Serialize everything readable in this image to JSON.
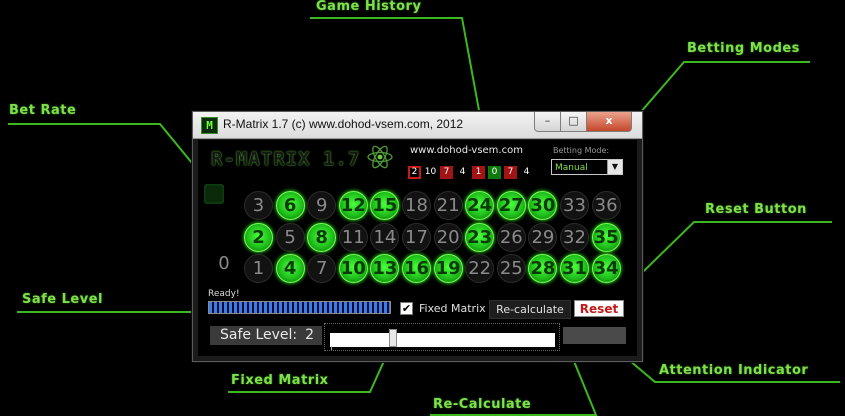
{
  "callouts": {
    "game_history": "Game History",
    "betting_modes": "Betting Modes",
    "bet_rate": "Bet Rate",
    "reset_button": "Reset Button",
    "safe_level": "Safe Level",
    "fixed_matrix": "Fixed Matrix",
    "recalculate": "Re-Calculate",
    "attention_indicator": "Attention Indicator"
  },
  "window": {
    "title": "R-Matrix 1.7 (c) www.dohod-vsem.com, 2012",
    "icon_letter": "M",
    "controls": {
      "minimize": "–",
      "maximize": "□",
      "close": "x"
    }
  },
  "header": {
    "logo": "R-MATRIX 1.7",
    "website": "www.dohod-vsem.com",
    "betting_mode_label": "Betting Mode:",
    "betting_mode_value": "Manual"
  },
  "history": [
    {
      "n": "2",
      "c": "first"
    },
    {
      "n": "10",
      "c": "black"
    },
    {
      "n": "7",
      "c": "red"
    },
    {
      "n": "4",
      "c": "black"
    },
    {
      "n": "1",
      "c": "red"
    },
    {
      "n": "0",
      "c": "green"
    },
    {
      "n": "7",
      "c": "red"
    },
    {
      "n": "4",
      "c": "black"
    }
  ],
  "table": {
    "zero": "0",
    "rows": [
      [
        {
          "n": "3",
          "on": false
        },
        {
          "n": "6",
          "on": true
        },
        {
          "n": "9",
          "on": false
        },
        {
          "n": "12",
          "on": true
        },
        {
          "n": "15",
          "on": true
        },
        {
          "n": "18",
          "on": false
        },
        {
          "n": "21",
          "on": false
        },
        {
          "n": "24",
          "on": true
        },
        {
          "n": "27",
          "on": true
        },
        {
          "n": "30",
          "on": true
        },
        {
          "n": "33",
          "on": false
        },
        {
          "n": "36",
          "on": false
        }
      ],
      [
        {
          "n": "2",
          "on": true
        },
        {
          "n": "5",
          "on": false
        },
        {
          "n": "8",
          "on": true
        },
        {
          "n": "11",
          "on": false
        },
        {
          "n": "14",
          "on": false
        },
        {
          "n": "17",
          "on": false
        },
        {
          "n": "20",
          "on": false
        },
        {
          "n": "23",
          "on": true
        },
        {
          "n": "26",
          "on": false
        },
        {
          "n": "29",
          "on": false
        },
        {
          "n": "32",
          "on": false
        },
        {
          "n": "35",
          "on": true
        }
      ],
      [
        {
          "n": "1",
          "on": false
        },
        {
          "n": "4",
          "on": true
        },
        {
          "n": "7",
          "on": false
        },
        {
          "n": "10",
          "on": true
        },
        {
          "n": "13",
          "on": true
        },
        {
          "n": "16",
          "on": true
        },
        {
          "n": "19",
          "on": true
        },
        {
          "n": "22",
          "on": false
        },
        {
          "n": "25",
          "on": false
        },
        {
          "n": "28",
          "on": true
        },
        {
          "n": "31",
          "on": true
        },
        {
          "n": "34",
          "on": true
        }
      ]
    ]
  },
  "controls": {
    "status": "Ready!",
    "progress": 1.0,
    "fixed_matrix_label": "Fixed Matrix",
    "fixed_matrix_checked": true,
    "recalculate_label": "Re-calculate",
    "reset_label": "Reset",
    "safe_level_label": "Safe Level:",
    "safe_level_value": "2",
    "safe_level_slider": 0.27
  },
  "colors": {
    "accent_green": "#4bff3d",
    "callout_green": "#7ee04a",
    "history_red": "#a01414",
    "reset_red": "#c21a1a"
  }
}
